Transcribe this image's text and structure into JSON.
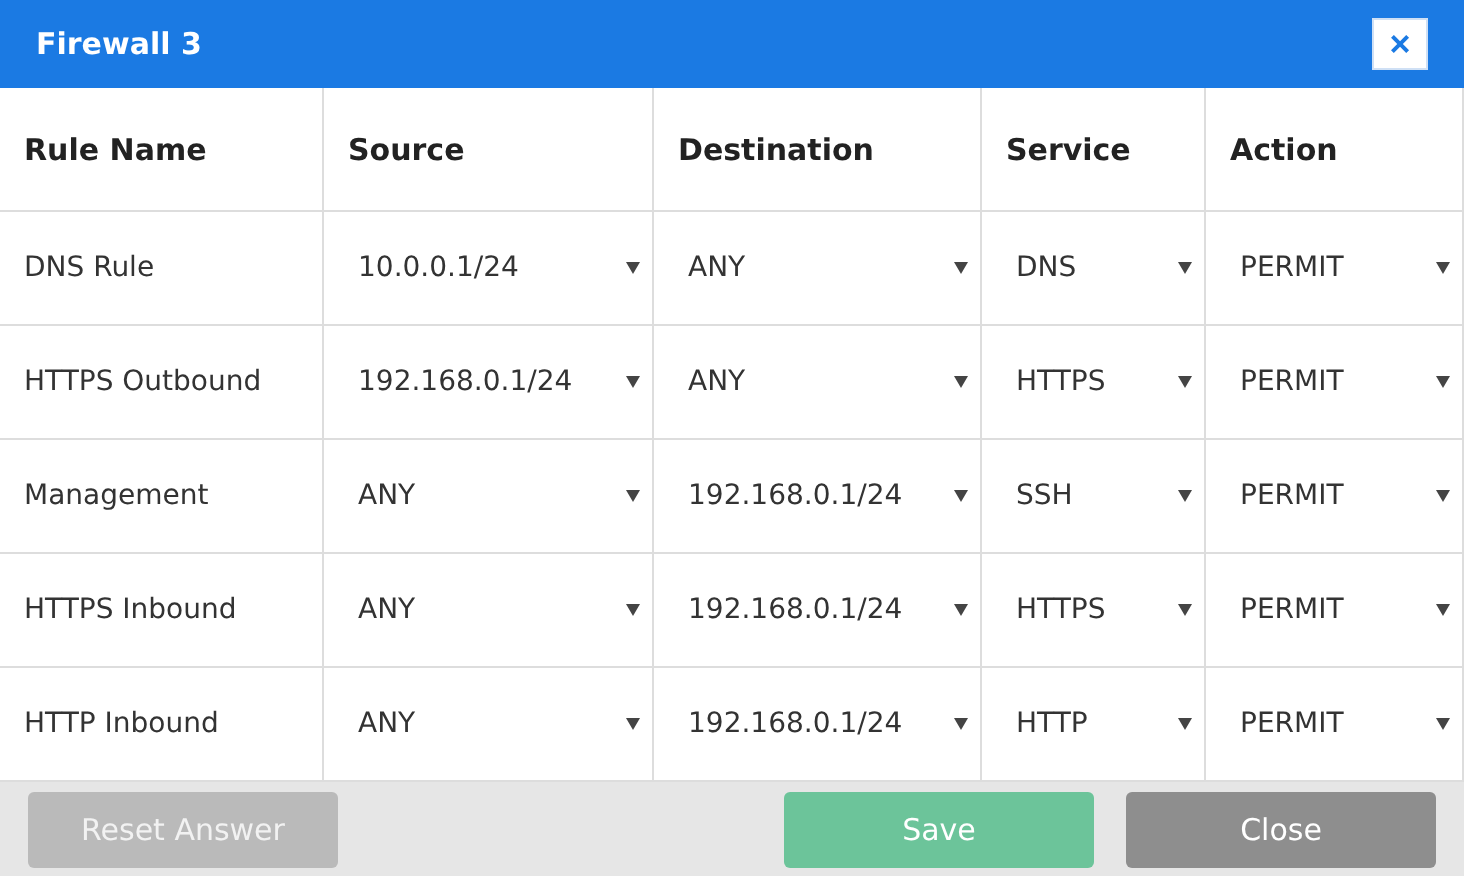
{
  "window": {
    "title": "Firewall 3",
    "close_label": "×"
  },
  "table": {
    "columns": [
      "Rule Name",
      "Source",
      "Destination",
      "Service",
      "Action"
    ],
    "rows": [
      {
        "name": "DNS Rule",
        "source": "10.0.0.1/24",
        "destination": "ANY",
        "service": "DNS",
        "action": "PERMIT"
      },
      {
        "name": "HTTPS Outbound",
        "source": "192.168.0.1/24",
        "destination": "ANY",
        "service": "HTTPS",
        "action": "PERMIT"
      },
      {
        "name": "Management",
        "source": "ANY",
        "destination": "192.168.0.1/24",
        "service": "SSH",
        "action": "PERMIT"
      },
      {
        "name": "HTTPS Inbound",
        "source": "ANY",
        "destination": "192.168.0.1/24",
        "service": "HTTPS",
        "action": "PERMIT"
      },
      {
        "name": "HTTP Inbound",
        "source": "ANY",
        "destination": "192.168.0.1/24",
        "service": "HTTP",
        "action": "PERMIT"
      }
    ]
  },
  "buttons": [
    {
      "label": "Reset Answer",
      "kind": "reset",
      "disabled": true
    },
    {
      "label": "Save",
      "kind": "save",
      "disabled": false
    },
    {
      "label": "Close",
      "kind": "close",
      "disabled": false
    }
  ]
}
